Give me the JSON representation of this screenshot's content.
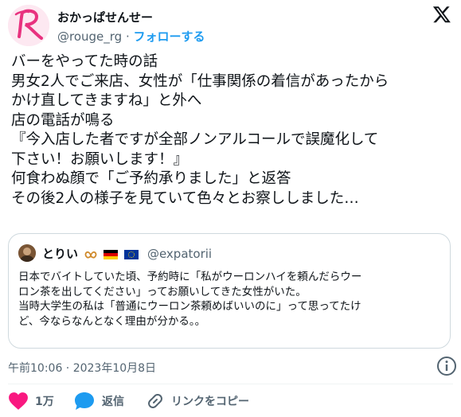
{
  "user": {
    "name": "おかっぱせんせー",
    "handle": "@rouge_rg",
    "separator": "·",
    "follow": "フォローする"
  },
  "body_lines": [
    "バーをやってた時の話",
    "男女2人でご来店、女性が「仕事関係の着信があったから",
    "かけ直してきますね」と外へ",
    "店の電話が鳴る",
    "『今入店した者ですが全部ノンアルコールで誤魔化して",
    "下さい！お願いします！』",
    "何食わぬ顔で「ご予約承りました」と返答",
    "その後2人の様子を見ていて色々とお察ししました…"
  ],
  "quote": {
    "name": "とりい",
    "handle": "@expatorii",
    "lines": [
      "日本でバイトしていた頃、予約時に「私がウーロンハイを頼んだらウー",
      "ロン茶を出してください」ってお願いしてきた女性がいた。",
      "当時大学生の私は「普通にウーロン茶頼めばいいのに」って思ってたけ",
      "ど、今ならなんとなく理由が分かる。。"
    ]
  },
  "timestamp": "午前10:06 · 2023年10月8日",
  "actions": {
    "likes": "1万",
    "reply": "返信",
    "copy_link": "リンクをコピー"
  },
  "colors": {
    "like": "#f91880",
    "reply": "#1d9bf0",
    "follow": "#1d9bf0",
    "secondary_text": "#536471"
  }
}
